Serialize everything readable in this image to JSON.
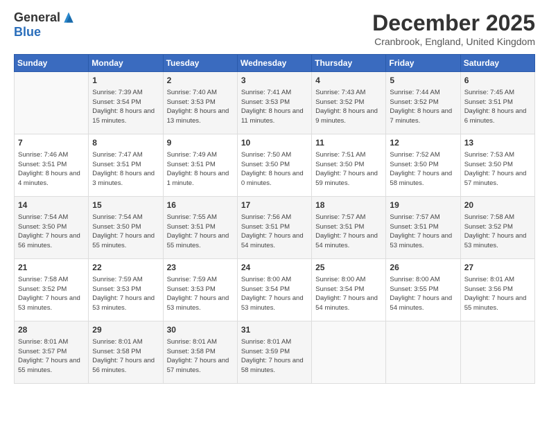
{
  "logo": {
    "general": "General",
    "blue": "Blue"
  },
  "title": "December 2025",
  "location": "Cranbrook, England, United Kingdom",
  "days_of_week": [
    "Sunday",
    "Monday",
    "Tuesday",
    "Wednesday",
    "Thursday",
    "Friday",
    "Saturday"
  ],
  "weeks": [
    [
      {
        "day": "",
        "info": ""
      },
      {
        "day": "1",
        "sunrise": "Sunrise: 7:39 AM",
        "sunset": "Sunset: 3:54 PM",
        "daylight": "Daylight: 8 hours and 15 minutes."
      },
      {
        "day": "2",
        "sunrise": "Sunrise: 7:40 AM",
        "sunset": "Sunset: 3:53 PM",
        "daylight": "Daylight: 8 hours and 13 minutes."
      },
      {
        "day": "3",
        "sunrise": "Sunrise: 7:41 AM",
        "sunset": "Sunset: 3:53 PM",
        "daylight": "Daylight: 8 hours and 11 minutes."
      },
      {
        "day": "4",
        "sunrise": "Sunrise: 7:43 AM",
        "sunset": "Sunset: 3:52 PM",
        "daylight": "Daylight: 8 hours and 9 minutes."
      },
      {
        "day": "5",
        "sunrise": "Sunrise: 7:44 AM",
        "sunset": "Sunset: 3:52 PM",
        "daylight": "Daylight: 8 hours and 7 minutes."
      },
      {
        "day": "6",
        "sunrise": "Sunrise: 7:45 AM",
        "sunset": "Sunset: 3:51 PM",
        "daylight": "Daylight: 8 hours and 6 minutes."
      }
    ],
    [
      {
        "day": "7",
        "sunrise": "Sunrise: 7:46 AM",
        "sunset": "Sunset: 3:51 PM",
        "daylight": "Daylight: 8 hours and 4 minutes."
      },
      {
        "day": "8",
        "sunrise": "Sunrise: 7:47 AM",
        "sunset": "Sunset: 3:51 PM",
        "daylight": "Daylight: 8 hours and 3 minutes."
      },
      {
        "day": "9",
        "sunrise": "Sunrise: 7:49 AM",
        "sunset": "Sunset: 3:51 PM",
        "daylight": "Daylight: 8 hours and 1 minute."
      },
      {
        "day": "10",
        "sunrise": "Sunrise: 7:50 AM",
        "sunset": "Sunset: 3:50 PM",
        "daylight": "Daylight: 8 hours and 0 minutes."
      },
      {
        "day": "11",
        "sunrise": "Sunrise: 7:51 AM",
        "sunset": "Sunset: 3:50 PM",
        "daylight": "Daylight: 7 hours and 59 minutes."
      },
      {
        "day": "12",
        "sunrise": "Sunrise: 7:52 AM",
        "sunset": "Sunset: 3:50 PM",
        "daylight": "Daylight: 7 hours and 58 minutes."
      },
      {
        "day": "13",
        "sunrise": "Sunrise: 7:53 AM",
        "sunset": "Sunset: 3:50 PM",
        "daylight": "Daylight: 7 hours and 57 minutes."
      }
    ],
    [
      {
        "day": "14",
        "sunrise": "Sunrise: 7:54 AM",
        "sunset": "Sunset: 3:50 PM",
        "daylight": "Daylight: 7 hours and 56 minutes."
      },
      {
        "day": "15",
        "sunrise": "Sunrise: 7:54 AM",
        "sunset": "Sunset: 3:50 PM",
        "daylight": "Daylight: 7 hours and 55 minutes."
      },
      {
        "day": "16",
        "sunrise": "Sunrise: 7:55 AM",
        "sunset": "Sunset: 3:51 PM",
        "daylight": "Daylight: 7 hours and 55 minutes."
      },
      {
        "day": "17",
        "sunrise": "Sunrise: 7:56 AM",
        "sunset": "Sunset: 3:51 PM",
        "daylight": "Daylight: 7 hours and 54 minutes."
      },
      {
        "day": "18",
        "sunrise": "Sunrise: 7:57 AM",
        "sunset": "Sunset: 3:51 PM",
        "daylight": "Daylight: 7 hours and 54 minutes."
      },
      {
        "day": "19",
        "sunrise": "Sunrise: 7:57 AM",
        "sunset": "Sunset: 3:51 PM",
        "daylight": "Daylight: 7 hours and 53 minutes."
      },
      {
        "day": "20",
        "sunrise": "Sunrise: 7:58 AM",
        "sunset": "Sunset: 3:52 PM",
        "daylight": "Daylight: 7 hours and 53 minutes."
      }
    ],
    [
      {
        "day": "21",
        "sunrise": "Sunrise: 7:58 AM",
        "sunset": "Sunset: 3:52 PM",
        "daylight": "Daylight: 7 hours and 53 minutes."
      },
      {
        "day": "22",
        "sunrise": "Sunrise: 7:59 AM",
        "sunset": "Sunset: 3:53 PM",
        "daylight": "Daylight: 7 hours and 53 minutes."
      },
      {
        "day": "23",
        "sunrise": "Sunrise: 7:59 AM",
        "sunset": "Sunset: 3:53 PM",
        "daylight": "Daylight: 7 hours and 53 minutes."
      },
      {
        "day": "24",
        "sunrise": "Sunrise: 8:00 AM",
        "sunset": "Sunset: 3:54 PM",
        "daylight": "Daylight: 7 hours and 53 minutes."
      },
      {
        "day": "25",
        "sunrise": "Sunrise: 8:00 AM",
        "sunset": "Sunset: 3:54 PM",
        "daylight": "Daylight: 7 hours and 54 minutes."
      },
      {
        "day": "26",
        "sunrise": "Sunrise: 8:00 AM",
        "sunset": "Sunset: 3:55 PM",
        "daylight": "Daylight: 7 hours and 54 minutes."
      },
      {
        "day": "27",
        "sunrise": "Sunrise: 8:01 AM",
        "sunset": "Sunset: 3:56 PM",
        "daylight": "Daylight: 7 hours and 55 minutes."
      }
    ],
    [
      {
        "day": "28",
        "sunrise": "Sunrise: 8:01 AM",
        "sunset": "Sunset: 3:57 PM",
        "daylight": "Daylight: 7 hours and 55 minutes."
      },
      {
        "day": "29",
        "sunrise": "Sunrise: 8:01 AM",
        "sunset": "Sunset: 3:58 PM",
        "daylight": "Daylight: 7 hours and 56 minutes."
      },
      {
        "day": "30",
        "sunrise": "Sunrise: 8:01 AM",
        "sunset": "Sunset: 3:58 PM",
        "daylight": "Daylight: 7 hours and 57 minutes."
      },
      {
        "day": "31",
        "sunrise": "Sunrise: 8:01 AM",
        "sunset": "Sunset: 3:59 PM",
        "daylight": "Daylight: 7 hours and 58 minutes."
      },
      {
        "day": "",
        "info": ""
      },
      {
        "day": "",
        "info": ""
      },
      {
        "day": "",
        "info": ""
      }
    ]
  ]
}
